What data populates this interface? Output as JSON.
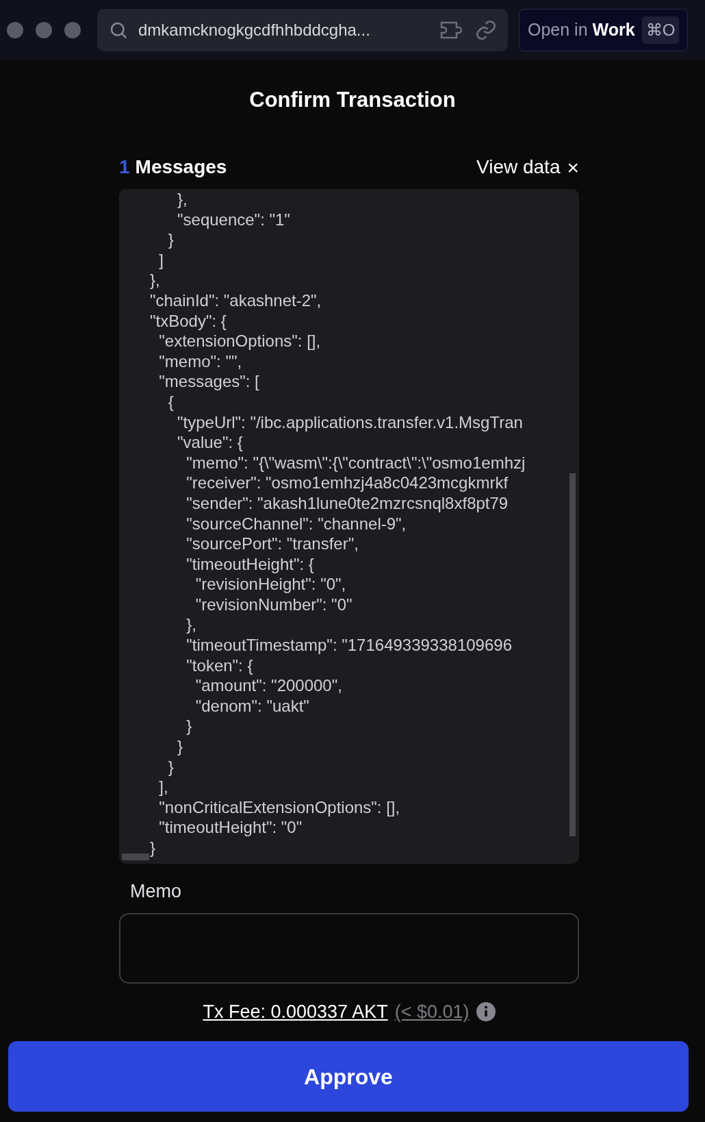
{
  "browser_bar": {
    "search_field": {
      "value": "dmkamcknogkgcdfhhbddcgha..."
    },
    "open_button": {
      "prefix": "Open in",
      "app": "Work",
      "shortcut": "⌘O"
    }
  },
  "title": "Confirm Transaction",
  "messages": {
    "count": "1",
    "label": "Messages",
    "view_data": "View data",
    "close": "×",
    "code_lines": [
      "      },",
      "      \"sequence\": \"1\"",
      "    }",
      "  ]",
      "},",
      "\"chainId\": \"akashnet-2\",",
      "\"txBody\": {",
      "  \"extensionOptions\": [],",
      "  \"memo\": \"\",",
      "  \"messages\": [",
      "    {",
      "      \"typeUrl\": \"/ibc.applications.transfer.v1.MsgTran",
      "      \"value\": {",
      "        \"memo\": \"{\\\"wasm\\\":{\\\"contract\\\":\\\"osmo1emhzj",
      "        \"receiver\": \"osmo1emhzj4a8c0423mcgkmrkf",
      "        \"sender\": \"akash1lune0te2mzrcsnql8xf8pt79",
      "        \"sourceChannel\": \"channel-9\",",
      "        \"sourcePort\": \"transfer\",",
      "        \"timeoutHeight\": {",
      "          \"revisionHeight\": \"0\",",
      "          \"revisionNumber\": \"0\"",
      "        },",
      "        \"timeoutTimestamp\": \"171649339338109696",
      "        \"token\": {",
      "          \"amount\": \"200000\",",
      "          \"denom\": \"uakt\"",
      "        }",
      "      }",
      "    }",
      "  ],",
      "  \"nonCriticalExtensionOptions\": [],",
      "  \"timeoutHeight\": \"0\"",
      "}"
    ]
  },
  "memo": {
    "label": "Memo"
  },
  "fee": {
    "label": "Tx Fee: 0.000337 AKT",
    "usd": "(< $0.01)"
  },
  "approve_button": "Approve"
}
